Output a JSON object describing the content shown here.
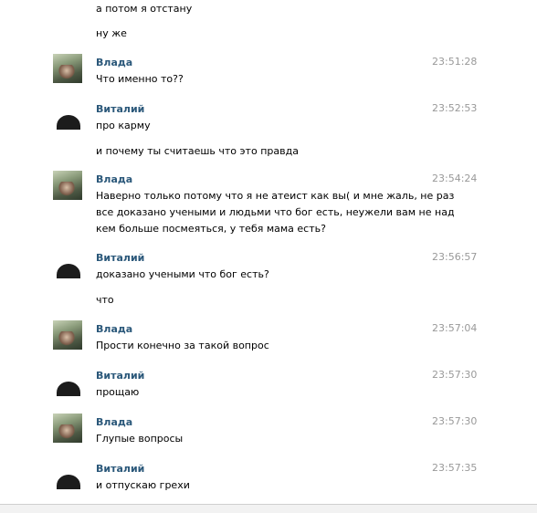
{
  "messages": [
    {
      "continuation": true,
      "lines": [
        "а потом я отстану"
      ]
    },
    {
      "continuation": true,
      "lines": [
        "ну же"
      ]
    },
    {
      "author": "Влада",
      "avatar": "vlada",
      "time": "23:51:28",
      "lines": [
        "Что именно то??"
      ]
    },
    {
      "author": "Виталий",
      "avatar": "vitaly",
      "time": "23:52:53",
      "lines": [
        "про карму"
      ]
    },
    {
      "continuation": true,
      "lines": [
        "и почему ты считаешь что это правда"
      ]
    },
    {
      "author": "Влада",
      "avatar": "vlada",
      "time": "23:54:24",
      "lines": [
        "Наверно только потому что я не атеист как вы( и мне жаль, не раз",
        "все доказано учеными и людьми что бог есть, неужели вам не над",
        "кем больше посмеяться, у тебя мама есть?"
      ]
    },
    {
      "author": "Виталий",
      "avatar": "vitaly",
      "time": "23:56:57",
      "lines": [
        "доказано учеными что бог есть?"
      ]
    },
    {
      "continuation": true,
      "lines": [
        "что"
      ]
    },
    {
      "author": "Влада",
      "avatar": "vlada",
      "time": "23:57:04",
      "lines": [
        "Прости конечно за такой вопрос"
      ]
    },
    {
      "author": "Виталий",
      "avatar": "vitaly",
      "time": "23:57:30",
      "lines": [
        "прощаю"
      ]
    },
    {
      "author": "Влада",
      "avatar": "vlada",
      "time": "23:57:30",
      "lines": [
        "Глупые вопросы"
      ]
    },
    {
      "author": "Виталий",
      "avatar": "vitaly",
      "time": "23:57:35",
      "lines": [
        "и отпускаю грехи"
      ]
    }
  ]
}
